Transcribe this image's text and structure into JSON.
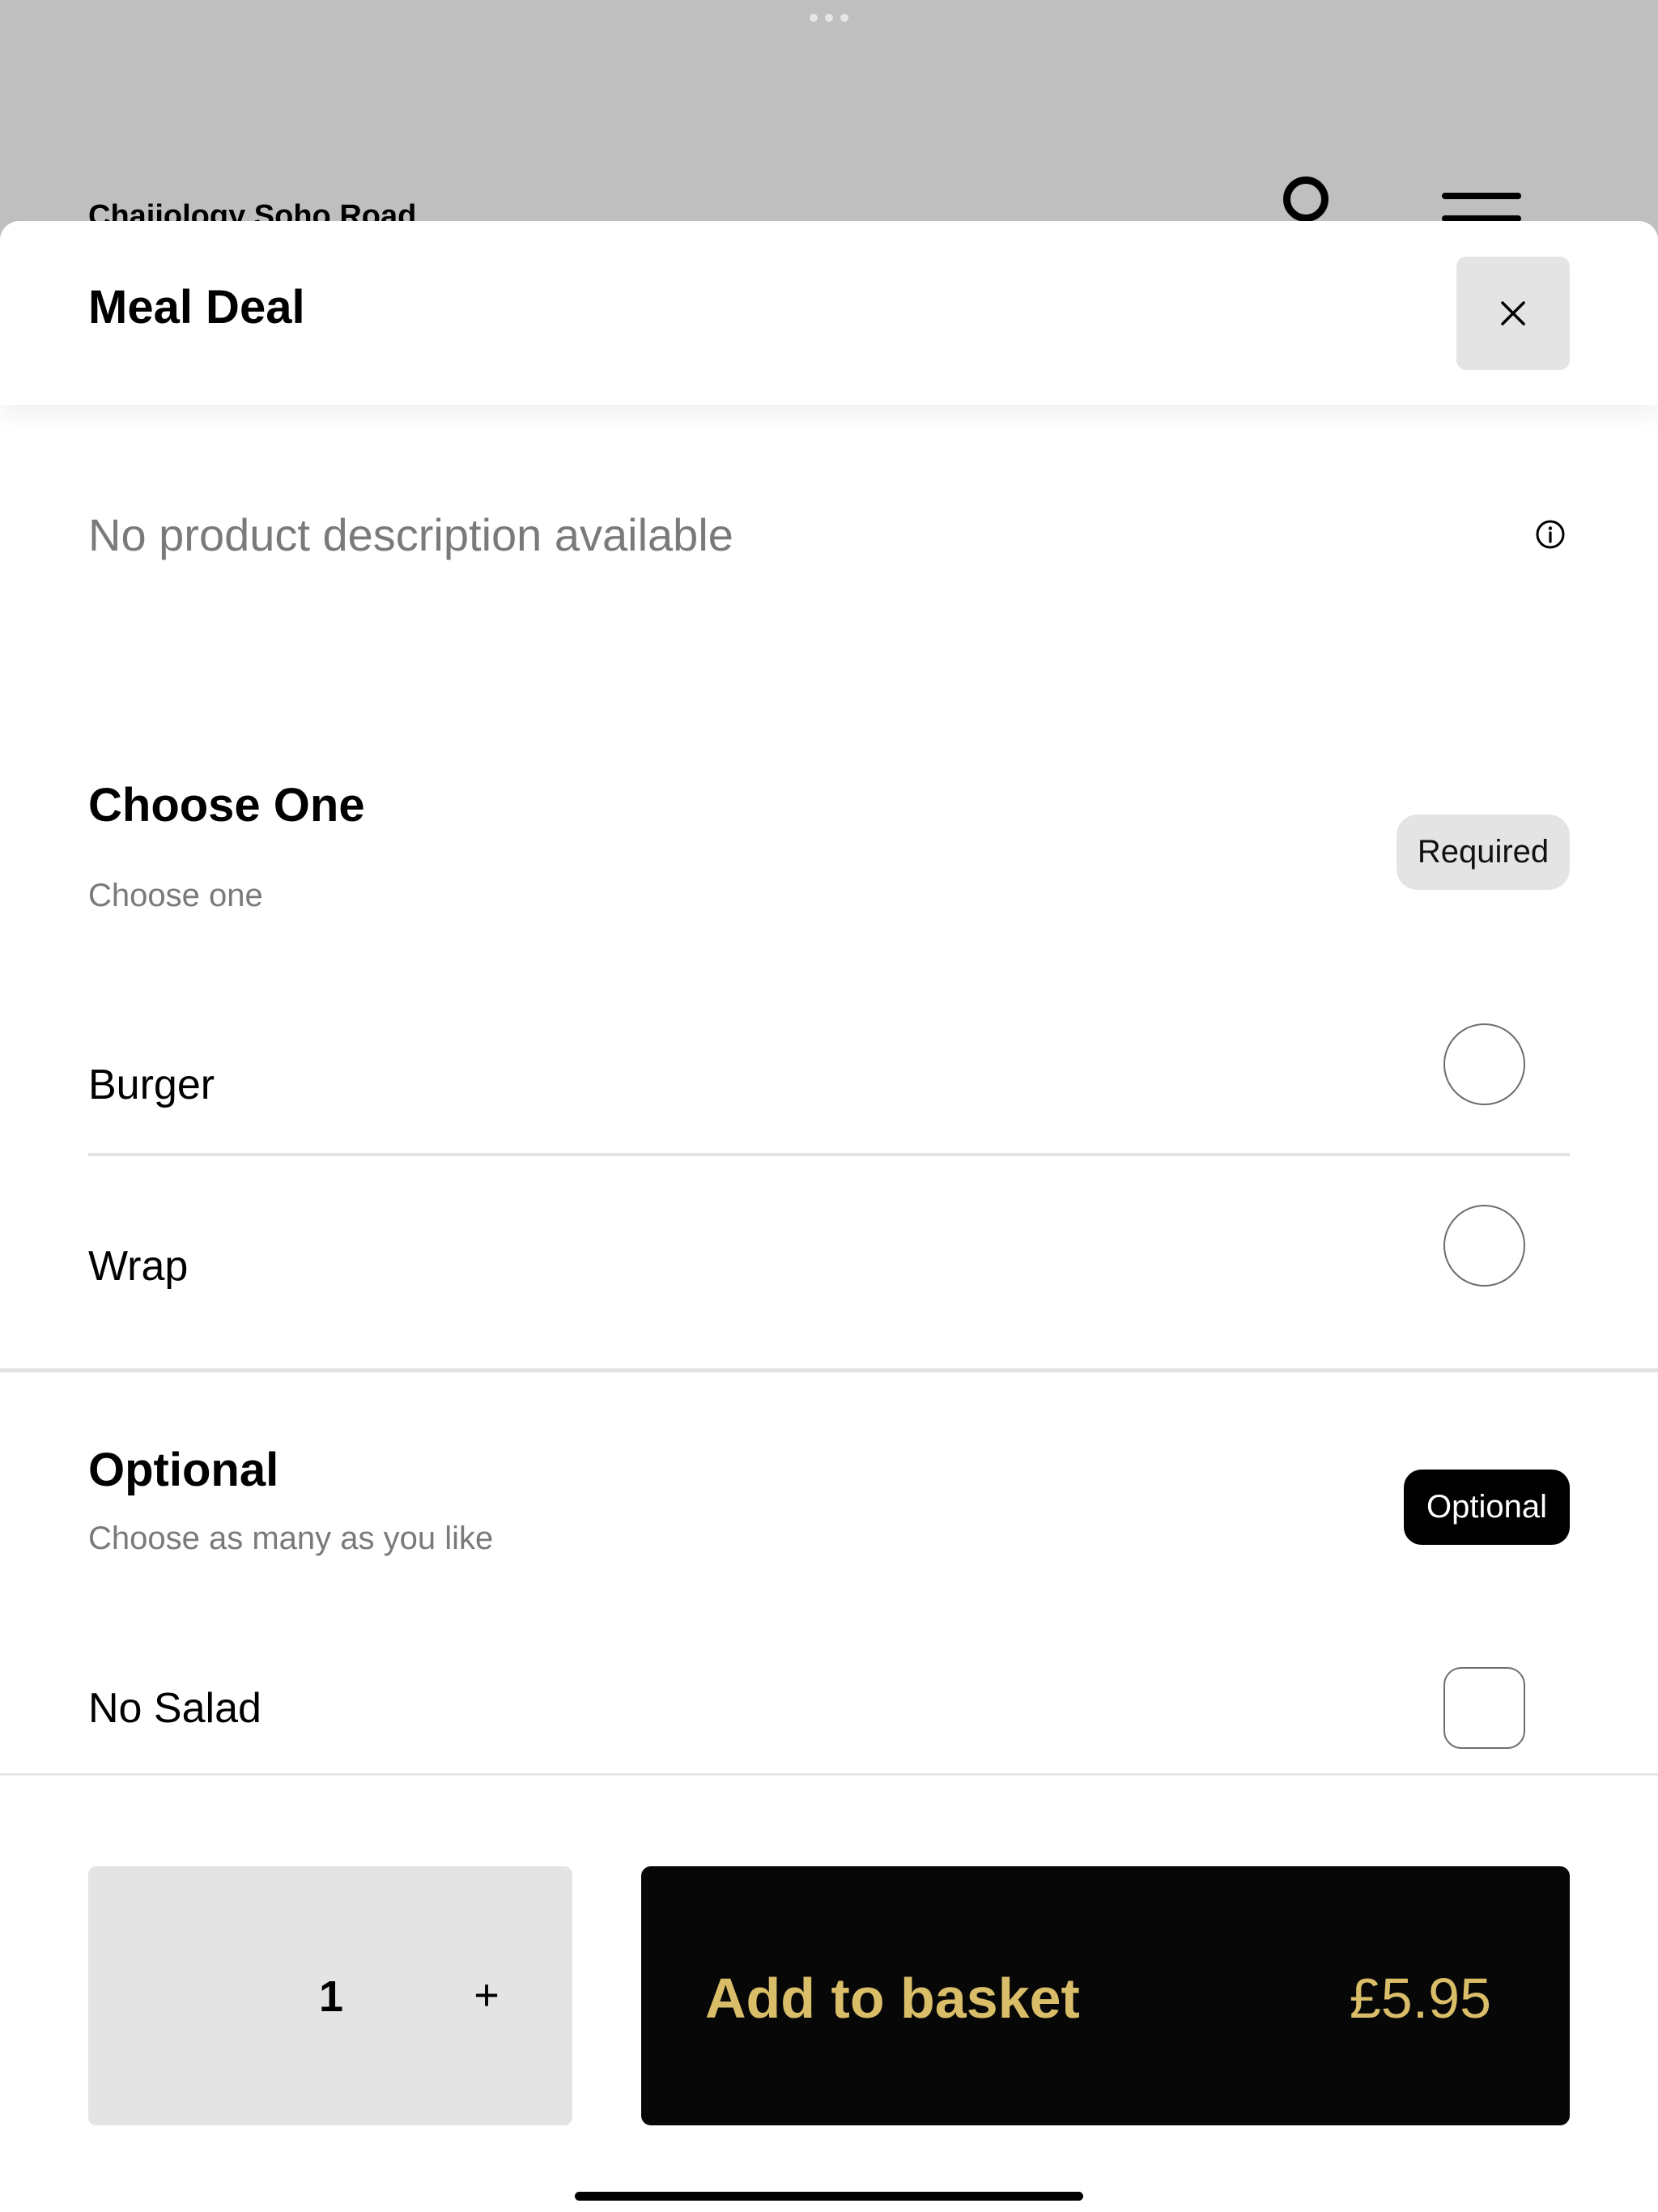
{
  "background": {
    "store_name": "Chaiiology Soho Road",
    "overlay_color": "#bfbfbf"
  },
  "sheet": {
    "title": "Meal Deal",
    "close_icon": "close-icon",
    "description": "No product description available",
    "info_icon": "info-icon"
  },
  "sections": [
    {
      "title": "Choose One",
      "subtitle": "Choose one",
      "badge": "Required",
      "type": "radio",
      "options": [
        {
          "label": "Burger",
          "selected": false
        },
        {
          "label": "Wrap",
          "selected": false
        }
      ]
    },
    {
      "title": "Optional",
      "subtitle": "Choose as many as you like",
      "badge": "Optional",
      "type": "checkbox",
      "options": [
        {
          "label": "No Salad",
          "checked": false
        }
      ]
    }
  ],
  "footer": {
    "quantity": "1",
    "plus_label": "+",
    "add_label": "Add to basket",
    "price": "£5.95",
    "accent_color": "#d9bd68",
    "button_color": "#070707"
  }
}
